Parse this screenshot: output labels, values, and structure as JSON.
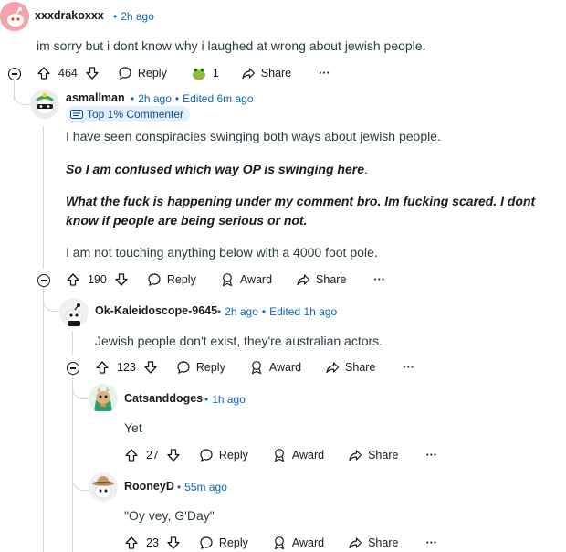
{
  "comments": {
    "c1": {
      "author": "xxxdrakoxxx",
      "time": "2h ago",
      "body": "im sorry but i dont know why i laughed at wrong about jewish people.",
      "score": "464",
      "reply": "Reply",
      "award_count": "1",
      "share": "Share",
      "more": "···"
    },
    "c2": {
      "author": "asmallman",
      "time": "2h ago",
      "edited": "Edited 6m ago",
      "flair": "Top 1% Commenter",
      "p1": "I have seen conspiracies swinging both ways about jewish people.",
      "p2": "So I am confused which way OP is swinging here",
      "p2_end": ".",
      "p3_l1": "What the fuck is happening under my comment bro. Im fucking scared. I dont",
      "p3_l2": "know if people are being serious or not.",
      "p4": "I am not touching anything below with a 4000 foot pole.",
      "score": "190",
      "reply": "Reply",
      "award": "Award",
      "share": "Share",
      "more": "···"
    },
    "c3": {
      "author": "Ok-Kaleidoscope-9645",
      "time": "2h ago",
      "edited": "Edited 1h ago",
      "body": "Jewish people don't exist, they're australian actors.",
      "score": "123",
      "reply": "Reply",
      "award": "Award",
      "share": "Share",
      "more": "···"
    },
    "c4": {
      "author": "Catsanddoges",
      "time": "1h ago",
      "body": "Yet",
      "score": "27",
      "reply": "Reply",
      "award": "Award",
      "share": "Share",
      "more": "···"
    },
    "c5": {
      "author": "RooneyD",
      "time": "55m ago",
      "body": "\"Oy vey, G'Day\"",
      "score": "23",
      "reply": "Reply",
      "award": "Award",
      "share": "Share",
      "more": "···"
    }
  },
  "colors": {
    "meta_blue": "#0a66c2",
    "text": "#1a1a1b",
    "muted": "#576f76",
    "thread": "#d7dadc",
    "flair_bg": "#e5f0ff"
  }
}
